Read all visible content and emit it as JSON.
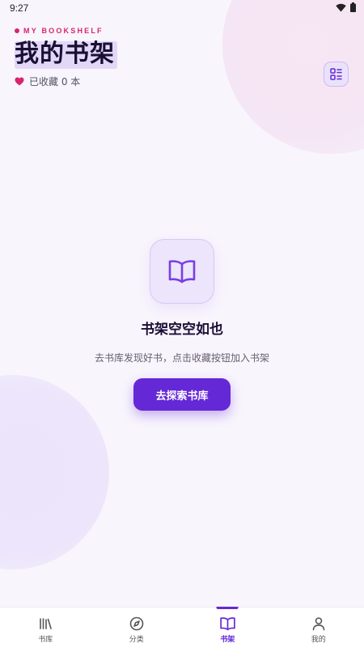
{
  "status_bar": {
    "time": "9:27"
  },
  "header": {
    "eyebrow": "MY BOOKSHELF",
    "title": "我的书架",
    "favorites_label": "已收藏 0 本",
    "view_toggle_icon": "grid-list-icon"
  },
  "empty_state": {
    "icon": "book-open-icon",
    "title": "书架空空如也",
    "description": "去书库发现好书，点击收藏按钮加入书架",
    "button_label": "去探索书库"
  },
  "nav": {
    "items": [
      {
        "label": "书库",
        "icon": "library-icon",
        "active": false
      },
      {
        "label": "分类",
        "icon": "compass-icon",
        "active": false
      },
      {
        "label": "书架",
        "icon": "book-open-icon",
        "active": true
      },
      {
        "label": "我的",
        "icon": "user-icon",
        "active": false
      }
    ]
  },
  "colors": {
    "accent": "#6528d6",
    "eyebrow_pink": "#d8246e",
    "background": "#f8f5fd"
  }
}
